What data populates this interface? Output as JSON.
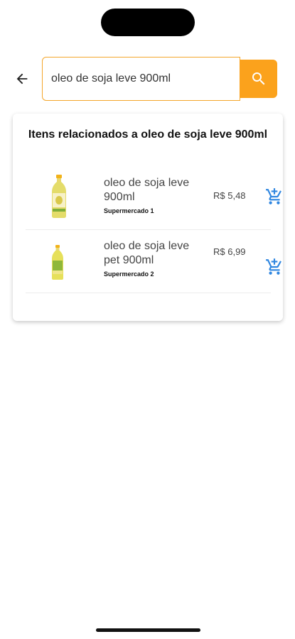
{
  "search": {
    "value": "oleo de soja leve 900ml"
  },
  "results": {
    "title": "Itens relacionados a oleo de soja leve 900ml",
    "items": [
      {
        "name": "oleo de soja leve 900ml",
        "store": "Supermercado 1",
        "price": "R$ 5,48",
        "icon": "add-to-cart-icon"
      },
      {
        "name": "oleo de soja leve pet 900ml",
        "store": "Supermercado 2",
        "price": "R$ 6,99",
        "icon": "add-to-cart-icon"
      }
    ]
  },
  "colors": {
    "accent": "#fba21c",
    "search_border": "#f4a62a",
    "cart_icon": "#2f86e0"
  }
}
